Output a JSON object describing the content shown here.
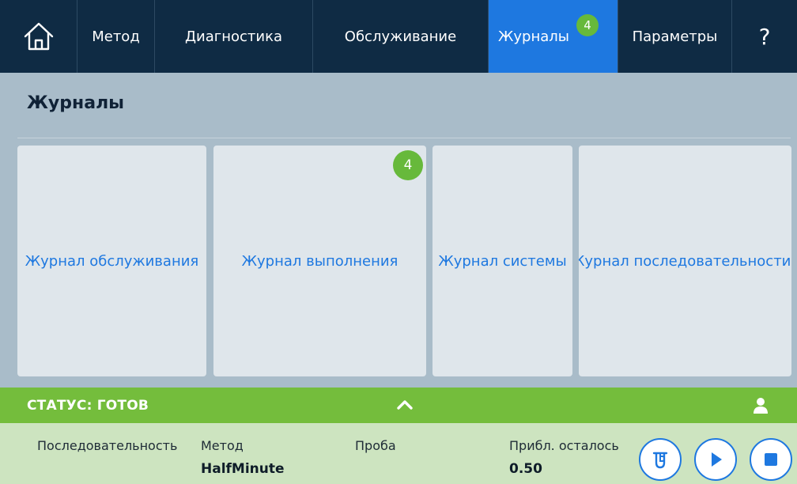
{
  "nav": {
    "home_icon": "home-icon",
    "items": [
      {
        "label": "Метод"
      },
      {
        "label": "Диагностика"
      },
      {
        "label": "Обслуживание"
      },
      {
        "label": "Журналы",
        "badge": "4",
        "active": true
      },
      {
        "label": "Параметры"
      },
      {
        "label": "?"
      }
    ]
  },
  "page": {
    "title": "Журналы",
    "tiles": [
      {
        "label": "Журнал обслуживания"
      },
      {
        "label": "Журнал выполнения",
        "badge": "4"
      },
      {
        "label": "Журнал системы"
      },
      {
        "label": "Журнал последовательности"
      }
    ]
  },
  "status": {
    "text": "СТАТУС: ГОТОВ",
    "chevron_icon": "chevron-up-icon",
    "user_icon": "user-icon",
    "columns": [
      {
        "label": "Последовательность",
        "value": ""
      },
      {
        "label": "Метод",
        "value": "HalfMinute"
      },
      {
        "label": "Проба",
        "value": ""
      },
      {
        "label": "Прибл. осталось",
        "value": "0.50"
      }
    ],
    "buttons": [
      {
        "icon": "sample-tube-icon"
      },
      {
        "icon": "play-icon"
      },
      {
        "icon": "stop-icon"
      }
    ]
  },
  "colors": {
    "nav_bg": "#0f2b44",
    "active": "#1e78e0",
    "badge": "#67b93b",
    "status_green": "#74bd3c",
    "status_panel": "#cde4c0",
    "content_bg": "#a9bcc9",
    "tile_bg": "#dfe6eb"
  }
}
